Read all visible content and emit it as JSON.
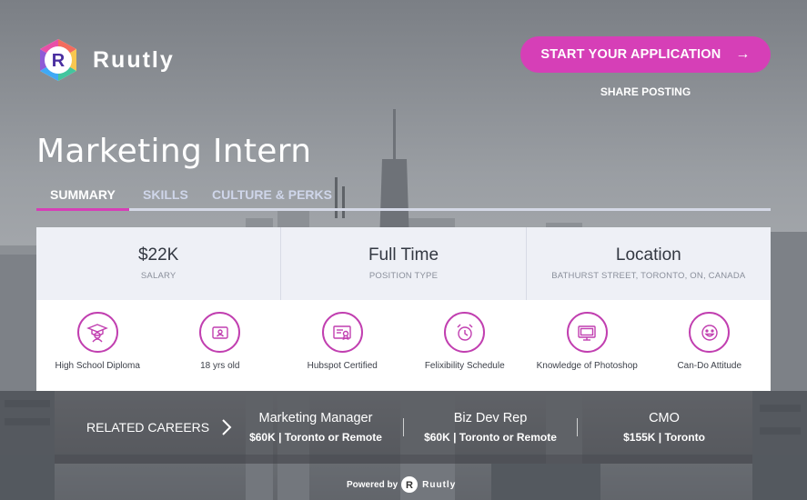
{
  "brand": {
    "name": "Ruutly",
    "logo_letter": "R",
    "colors": {
      "accent": "#d63fb7",
      "logo_purple": "#4a2fa0"
    }
  },
  "header": {
    "apply_label": "START YOUR APPLICATION",
    "apply_arrow": "→",
    "share_label": "SHARE POSTING"
  },
  "job": {
    "title": "Marketing Intern"
  },
  "tabs": [
    {
      "label": "SUMMARY",
      "active": true
    },
    {
      "label": "SKILLS",
      "active": false
    },
    {
      "label": "CULTURE & PERKS",
      "active": false
    }
  ],
  "stats": [
    {
      "value": "$22K",
      "label": "SALARY"
    },
    {
      "value": "Full Time",
      "label": "POSITION TYPE"
    },
    {
      "value": "Location",
      "label": "BATHURST STREET, TORONTO, ON, CANADA"
    }
  ],
  "skills": [
    {
      "label": "High School Diploma",
      "icon": "graduate-icon"
    },
    {
      "label": "18 yrs old",
      "icon": "id-card-icon"
    },
    {
      "label": "Hubspot Certified",
      "icon": "certificate-icon"
    },
    {
      "label": "Felixibility Schedule",
      "icon": "alarm-clock-icon"
    },
    {
      "label": "Knowledge of Photoshop",
      "icon": "monitor-icon"
    },
    {
      "label": "Can-Do Attitude",
      "icon": "smiley-icon"
    }
  ],
  "related": {
    "title": "RELATED CAREERS",
    "careers": [
      {
        "name": "Marketing Manager",
        "meta": "$60K | Toronto or Remote"
      },
      {
        "name": "Biz Dev Rep",
        "meta": "$60K | Toronto or Remote"
      },
      {
        "name": "CMO",
        "meta": "$155K | Toronto"
      }
    ]
  },
  "footer": {
    "powered_by": "Powered by",
    "brand": "Ruutly",
    "logo_letter": "R"
  }
}
